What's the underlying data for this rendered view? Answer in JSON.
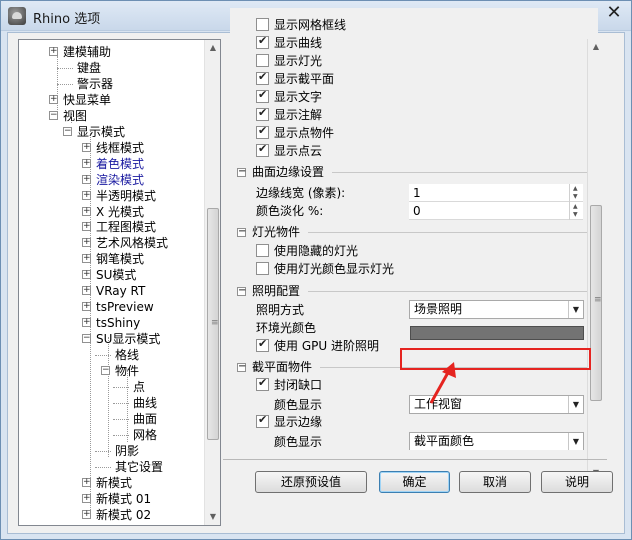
{
  "window": {
    "title": "Rhino 选项",
    "close_glyph": "✕"
  },
  "tree": {
    "items": [
      {
        "label": "建模辅助",
        "expander": "+",
        "color": "default"
      },
      {
        "label": "键盘",
        "expander": "",
        "color": "default"
      },
      {
        "label": "警示器",
        "expander": "",
        "color": "default"
      },
      {
        "label": "快显菜单",
        "expander": "+",
        "color": "default"
      },
      {
        "label": "视图",
        "expander": "-",
        "color": "default"
      },
      {
        "label": "显示模式",
        "expander": "-",
        "color": "default"
      },
      {
        "label": "线框模式",
        "expander": "+",
        "color": "default"
      },
      {
        "label": "着色模式",
        "expander": "+",
        "color": "blue"
      },
      {
        "label": "渲染模式",
        "expander": "+",
        "color": "blue"
      },
      {
        "label": "半透明模式",
        "expander": "+",
        "color": "default"
      },
      {
        "label": "X 光模式",
        "expander": "+",
        "color": "default"
      },
      {
        "label": "工程图模式",
        "expander": "+",
        "color": "default"
      },
      {
        "label": "艺术风格模式",
        "expander": "+",
        "color": "default"
      },
      {
        "label": "钢笔模式",
        "expander": "+",
        "color": "default"
      },
      {
        "label": "SU模式",
        "expander": "+",
        "color": "default"
      },
      {
        "label": "VRay RT",
        "expander": "+",
        "color": "default"
      },
      {
        "label": "tsPreview",
        "expander": "+",
        "color": "default"
      },
      {
        "label": "tsShiny",
        "expander": "+",
        "color": "default"
      },
      {
        "label": "SU显示模式",
        "expander": "-",
        "color": "default"
      },
      {
        "label": "格线",
        "expander": "",
        "color": "default"
      },
      {
        "label": "物件",
        "expander": "-",
        "color": "default"
      },
      {
        "label": "点",
        "expander": "",
        "color": "default"
      },
      {
        "label": "曲线",
        "expander": "",
        "color": "default"
      },
      {
        "label": "曲面",
        "expander": "",
        "color": "default"
      },
      {
        "label": "网格",
        "expander": "",
        "color": "default"
      },
      {
        "label": "阴影",
        "expander": "",
        "color": "default"
      },
      {
        "label": "其它设置",
        "expander": "",
        "color": "default"
      },
      {
        "label": "新模式",
        "expander": "+",
        "color": "default"
      },
      {
        "label": "新模式 01",
        "expander": "+",
        "color": "default"
      },
      {
        "label": "新模式 02",
        "expander": "+",
        "color": "default"
      }
    ]
  },
  "panel": {
    "display_checks": [
      {
        "label": "显示网格框线",
        "checked": false
      },
      {
        "label": "显示曲线",
        "checked": true
      },
      {
        "label": "显示灯光",
        "checked": false
      },
      {
        "label": "显示截平面",
        "checked": true
      },
      {
        "label": "显示文字",
        "checked": true
      },
      {
        "label": "显示注解",
        "checked": true
      },
      {
        "label": "显示点物件",
        "checked": true
      },
      {
        "label": "显示点云",
        "checked": true
      }
    ],
    "edge_section": {
      "title": "曲面边缘设置",
      "width_label": "边缘线宽 (像素):",
      "width_value": "1",
      "fade_label": "颜色淡化 %:",
      "fade_value": "0"
    },
    "light_section": {
      "title": "灯光物件",
      "checks": [
        {
          "label": "使用隐藏的灯光",
          "checked": false
        },
        {
          "label": "使用灯光颜色显示灯光",
          "checked": false
        }
      ]
    },
    "lighting_section": {
      "title": "照明配置",
      "method_label": "照明方式",
      "method_value": "场景照明",
      "ambient_label": "环境光颜色",
      "ambient_color": "#737373",
      "gpu_check": {
        "label": "使用 GPU 进阶照明",
        "checked": true
      }
    },
    "clipping_section": {
      "title": "截平面物件",
      "cap_check": {
        "label": "封闭缺口",
        "checked": true
      },
      "color_label": "颜色显示",
      "color_value": "工作视窗",
      "edge_check": {
        "label": "显示边缘",
        "checked": true
      },
      "edge_color_label": "颜色显示",
      "edge_color_value": "截平面颜色"
    }
  },
  "buttons": {
    "restore": "还原预设值",
    "ok": "确定",
    "cancel": "取消",
    "help": "说明"
  },
  "annotation": {
    "highlight_color": "#e52420"
  }
}
